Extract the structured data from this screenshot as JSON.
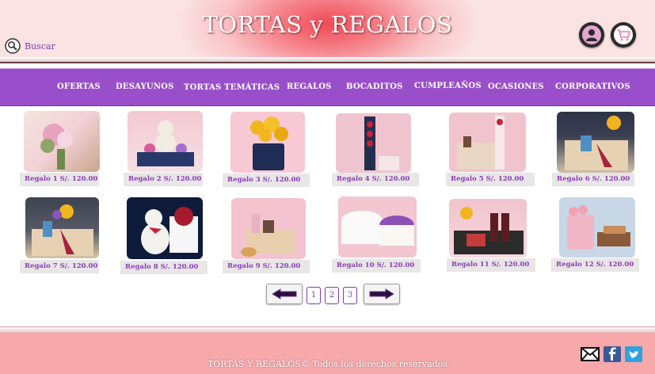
{
  "header": {
    "title": "TORTAS y REGALOS",
    "search_label": "Buscar"
  },
  "nav": {
    "items": [
      "OFERTAS",
      "DESAYUNOS",
      "TORTAS TEMÁTICAS",
      "REGALOS",
      "BOCADITOS",
      "CUMPLEAÑOS",
      "OCASIONES",
      "CORPORATIVOS"
    ]
  },
  "products": [
    {
      "caption": "Regalo 1  S/. 120.00"
    },
    {
      "caption": "Regalo 2  S/. 120.00"
    },
    {
      "caption": "Regalo 3  S/. 120.00"
    },
    {
      "caption": "Regalo 4  S/. 120.00"
    },
    {
      "caption": "Regalo 5  S/. 120.00"
    },
    {
      "caption": "Regalo 6  S/. 120.00"
    },
    {
      "caption": "Regalo 7  S/. 120.00"
    },
    {
      "caption": "Regalo 8 S/. 120.00"
    },
    {
      "caption": "Regalo 9 S/. 120.00"
    },
    {
      "caption": "Regalo 10  S/. 120.00"
    },
    {
      "caption": "Regalo 11  S/. 120.00"
    },
    {
      "caption": "Regalo 12  S/. 120.00"
    }
  ],
  "pagination": {
    "pages": [
      "1",
      "2",
      "3"
    ]
  },
  "footer": {
    "text": "TORTAS Y REGALOS© Todos los derechos reservados"
  },
  "colors": {
    "nav_background": "#9a4fca",
    "header_accent": "#f04a55",
    "footer_background": "#f6a8ab",
    "caption_text": "#8b3db6"
  }
}
